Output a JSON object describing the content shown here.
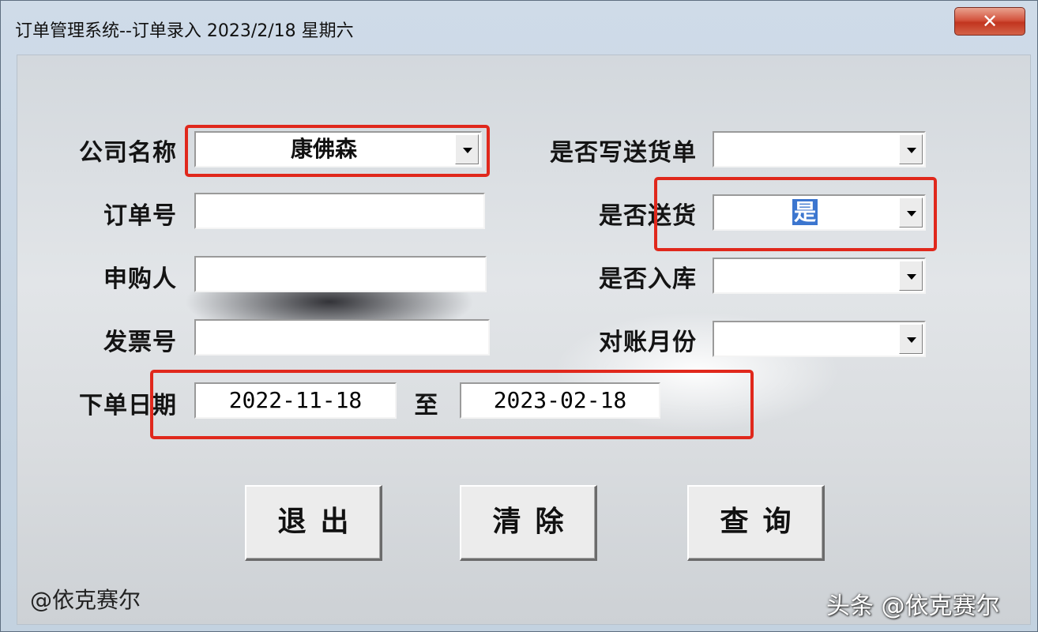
{
  "window": {
    "title": "订单管理系统--订单录入 2023/2/18 星期六",
    "close_glyph": "✕"
  },
  "form": {
    "company": {
      "label": "公司名称",
      "value": "康佛森"
    },
    "order_no": {
      "label": "订单号",
      "value": ""
    },
    "purchaser": {
      "label": "申购人",
      "value": ""
    },
    "invoice_no": {
      "label": "发票号",
      "value": ""
    },
    "order_date": {
      "label": "下单日期",
      "from": "2022-11-18",
      "separator": "至",
      "to": "2023-02-18"
    },
    "write_delivery_note": {
      "label": "是否写送货单",
      "value": ""
    },
    "delivered": {
      "label": "是否送货",
      "value": "是"
    },
    "stocked_in": {
      "label": "是否入库",
      "value": ""
    },
    "reconcile_month": {
      "label": "对账月份",
      "value": ""
    }
  },
  "buttons": {
    "exit": "退出",
    "clear": "清除",
    "query": "查询"
  },
  "watermarks": {
    "left": "@依克赛尔",
    "right": "头条 @依克赛尔"
  },
  "colors": {
    "highlight_box": "#e0281c",
    "selection": "#3c76cf",
    "close_button": "#c2351f"
  }
}
